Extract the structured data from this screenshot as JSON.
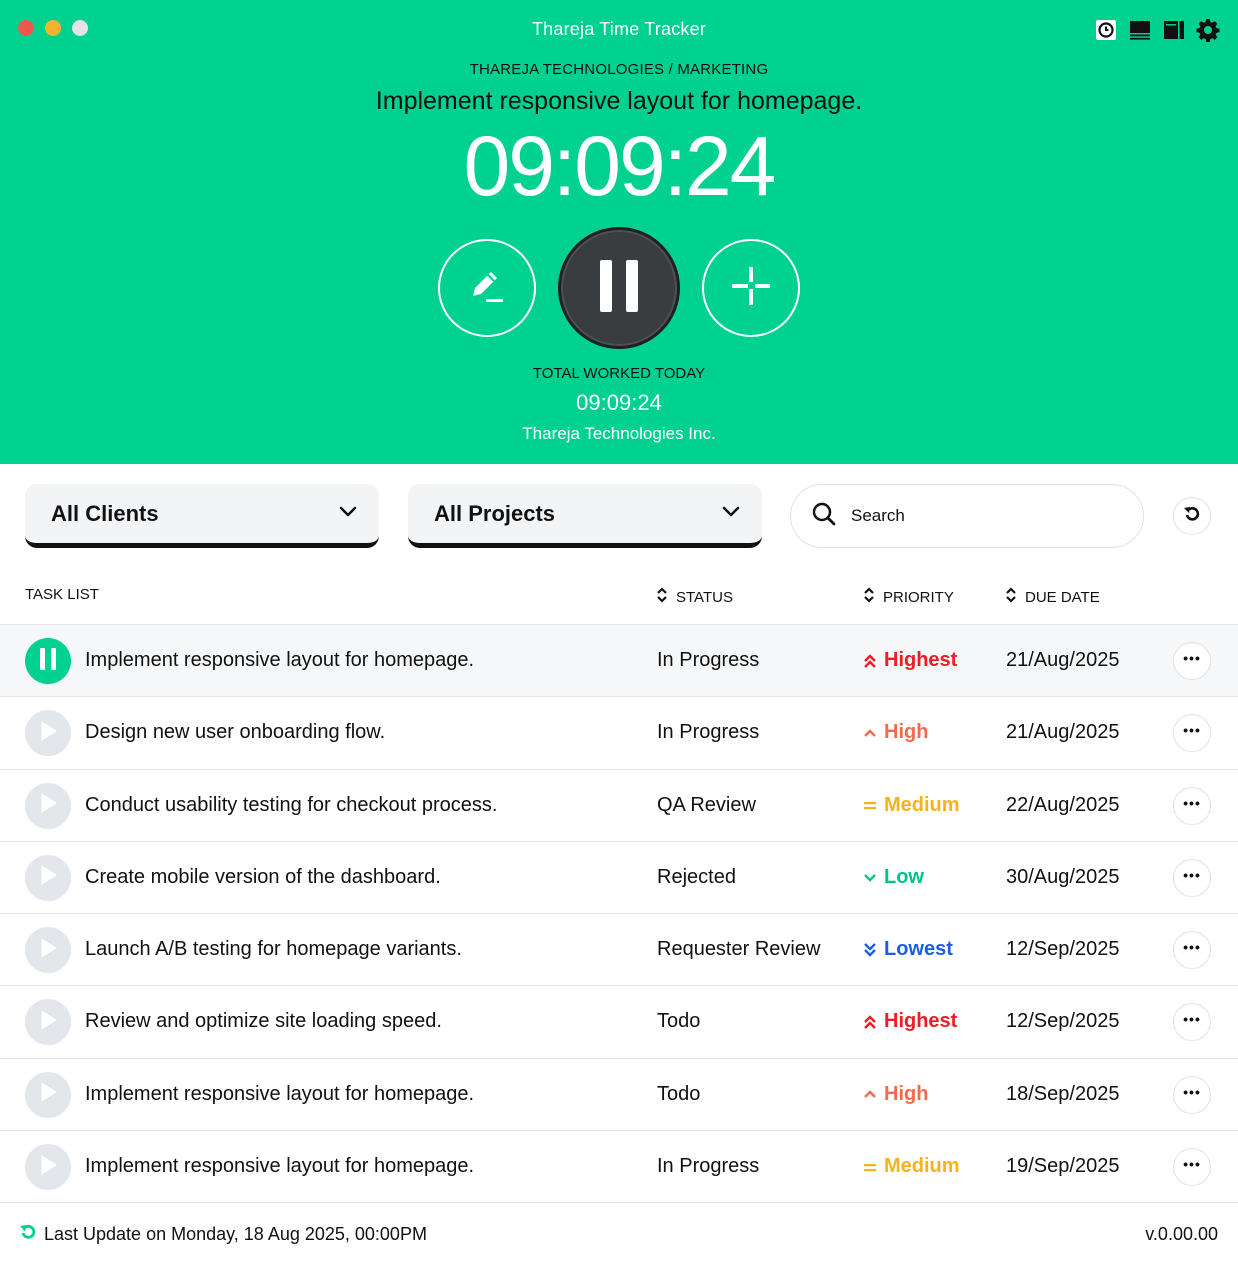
{
  "window": {
    "title": "Thareja Time Tracker"
  },
  "toolbar_icons": [
    "clock-icon",
    "compact-view-icon",
    "sidebar-view-icon",
    "gear-icon"
  ],
  "tracker": {
    "breadcrumb": "THAREJA TECHNOLOGIES / MARKETING",
    "task_title": "Implement responsive layout for homepage.",
    "timer": "09:09:24",
    "total_label": "TOTAL WORKED TODAY",
    "total_value": "09:09:24",
    "company": "Thareja Technologies Inc."
  },
  "filters": {
    "clients": "All Clients",
    "projects": "All Projects",
    "search_placeholder": "Search"
  },
  "table": {
    "headers": {
      "task": "TASK LIST",
      "status": "STATUS",
      "priority": "PRIORITY",
      "due": "DUE DATE"
    },
    "rows": [
      {
        "name": "Implement responsive layout for homepage.",
        "status": "In Progress",
        "priority": "Highest",
        "due": "21/Aug/2025",
        "active": true
      },
      {
        "name": "Design new user onboarding flow.",
        "status": "In Progress",
        "priority": "High",
        "due": "21/Aug/2025",
        "active": false
      },
      {
        "name": "Conduct usability testing for checkout process.",
        "status": "QA Review",
        "priority": "Medium",
        "due": "22/Aug/2025",
        "active": false
      },
      {
        "name": "Create mobile version of the dashboard.",
        "status": "Rejected",
        "priority": "Low",
        "due": "30/Aug/2025",
        "active": false
      },
      {
        "name": "Launch A/B testing for homepage variants.",
        "status": "Requester Review",
        "priority": "Lowest",
        "due": "12/Sep/2025",
        "active": false
      },
      {
        "name": "Review and optimize site loading speed.",
        "status": "Todo",
        "priority": "Highest",
        "due": "12/Sep/2025",
        "active": false
      },
      {
        "name": "Implement responsive layout for homepage.",
        "status": "Todo",
        "priority": "High",
        "due": "18/Sep/2025",
        "active": false
      },
      {
        "name": "Implement responsive layout for homepage.",
        "status": "In Progress",
        "priority": "Medium",
        "due": "19/Sep/2025",
        "active": false
      }
    ]
  },
  "priority_colors": {
    "Highest": "#ee1c25",
    "High": "#f26a4b",
    "Medium": "#f5b21b",
    "Low": "#00c48a",
    "Lowest": "#1a5fe0"
  },
  "theme": {
    "accent": "#00d18f"
  },
  "footer": {
    "last_update": "Last Update on Monday, 18 Aug 2025, 00:00PM",
    "version": "v.0.00.00"
  }
}
